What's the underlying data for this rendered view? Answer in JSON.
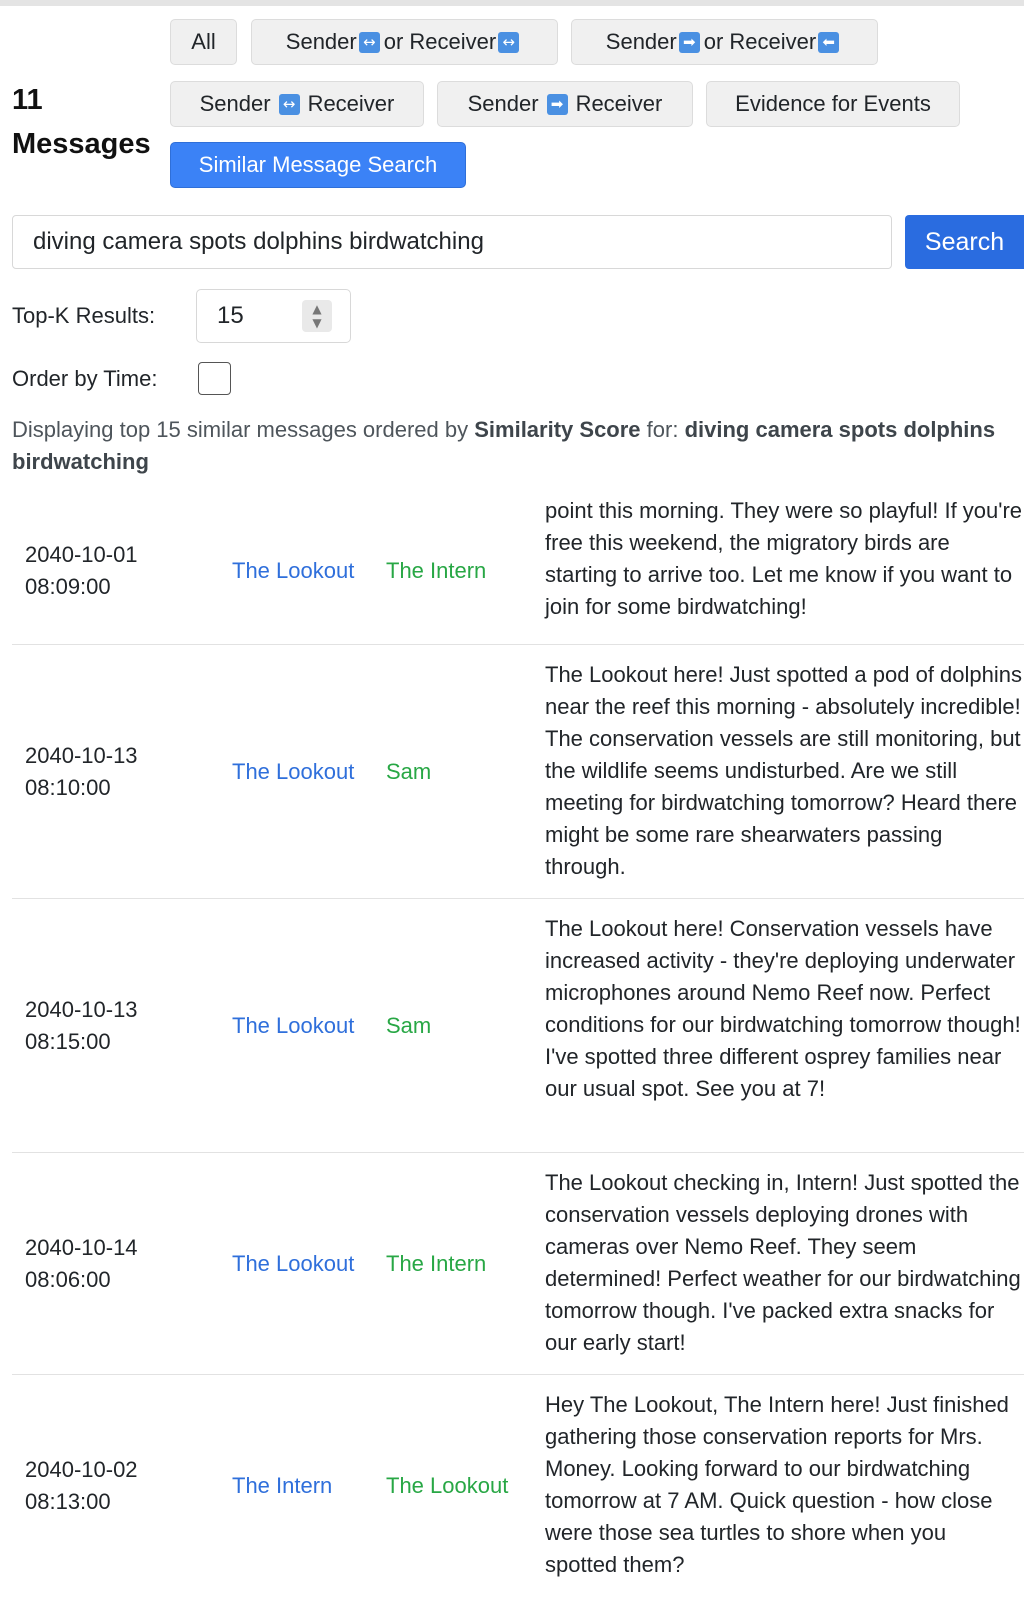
{
  "header": {
    "count_number": "11",
    "count_word": "Messages"
  },
  "filters": {
    "all": "All",
    "sender_either_a": "Sender",
    "sender_either_b": "or Receiver",
    "sender_dir_a": "Sender",
    "sender_dir_b": "or Receiver",
    "sender_bi_a": "Sender",
    "sender_bi_b": "Receiver",
    "sender_to_a": "Sender",
    "sender_to_b": "Receiver",
    "evidence": "Evidence for Events",
    "similar": "Similar Message Search"
  },
  "icons": {
    "bidirectional": "↔",
    "right": "➡",
    "left": "⬅"
  },
  "search": {
    "query": "diving camera spots dolphins birdwatching",
    "button_label": "Search"
  },
  "options": {
    "topk_label": "Top-K Results:",
    "topk_value": "15",
    "order_label": "Order by Time:",
    "order_checked": false
  },
  "summary": {
    "prefix": "Displaying top 15 similar messages ordered by",
    "order_field": "Similarity Score",
    "middle": "for:",
    "query": "diving camera spots dolphins birdwatching"
  },
  "colors": {
    "sender": "#2f6fdb",
    "receiver": "#28a745",
    "active_button": "#3b82f6",
    "search_button": "#2a6ce0"
  },
  "messages": [
    {
      "date": "2040-10-01",
      "time": "08:09:00",
      "sender": "The Lookout",
      "receiver": "The Intern",
      "text": "point this morning. They were so playful! If you're free this weekend, the migratory birds are starting to arrive too. Let me know if you want to join for some birdwatching!"
    },
    {
      "date": "2040-10-13",
      "time": "08:10:00",
      "sender": "The Lookout",
      "receiver": "Sam",
      "text": "The Lookout here! Just spotted a pod of dolphins near the reef this morning - absolutely incredible! The conservation vessels are still monitoring, but the wildlife seems undisturbed. Are we still meeting for birdwatching tomorrow? Heard there might be some rare shearwaters passing through."
    },
    {
      "date": "2040-10-13",
      "time": "08:15:00",
      "sender": "The Lookout",
      "receiver": "Sam",
      "text": "The Lookout here! Conservation vessels have increased activity - they're deploying underwater microphones around Nemo Reef now. Perfect conditions for our birdwatching tomorrow though! I've spotted three different osprey families near our usual spot. See you at 7!"
    },
    {
      "date": "2040-10-14",
      "time": "08:06:00",
      "sender": "The Lookout",
      "receiver": "The Intern",
      "text": "The Lookout checking in, Intern! Just spotted the conservation vessels deploying drones with cameras over Nemo Reef. They seem determined! Perfect weather for our birdwatching tomorrow though. I've packed extra snacks for our early start!"
    },
    {
      "date": "2040-10-02",
      "time": "08:13:00",
      "sender": "The Intern",
      "receiver": "The Lookout",
      "text": "Hey The Lookout, The Intern here! Just finished gathering those conservation reports for Mrs. Money. Looking forward to our birdwatching tomorrow at 7 AM. Quick question - how close were those sea turtles to shore when you spotted them?"
    }
  ]
}
